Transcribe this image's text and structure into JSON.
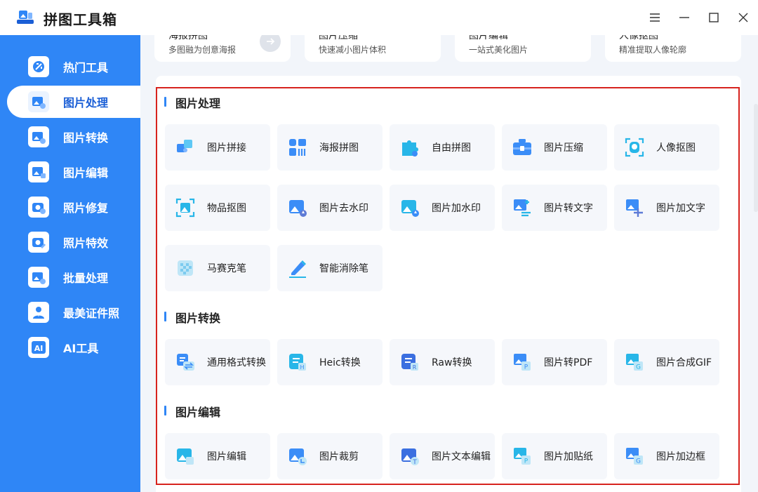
{
  "app": {
    "title": "拼图工具箱"
  },
  "window_controls": [
    "menu-icon",
    "minimize-icon",
    "maximize-icon",
    "close-icon"
  ],
  "colors": {
    "brand": "#2f86f6",
    "active_text": "#1b5fd6",
    "highlight_frame": "#d7231e"
  },
  "sidebar": {
    "items": [
      {
        "label": "热门工具",
        "icon": "tools-icon",
        "active": false
      },
      {
        "label": "图片处理",
        "icon": "image-process-icon",
        "active": true
      },
      {
        "label": "图片转换",
        "icon": "image-convert-icon",
        "active": false
      },
      {
        "label": "图片编辑",
        "icon": "image-edit-icon",
        "active": false
      },
      {
        "label": "照片修复",
        "icon": "photo-repair-icon",
        "active": false
      },
      {
        "label": "照片特效",
        "icon": "photo-effect-icon",
        "active": false
      },
      {
        "label": "批量处理",
        "icon": "batch-icon",
        "active": false
      },
      {
        "label": "最美证件照",
        "icon": "id-photo-icon",
        "active": false
      },
      {
        "label": "AI工具",
        "icon": "ai-icon",
        "active": false
      }
    ]
  },
  "promo_cards": [
    {
      "title": "海报拼图",
      "desc": "多图融为创意海报",
      "has_arrow": true
    },
    {
      "title": "图片压缩",
      "desc": "快速减小图片体积"
    },
    {
      "title": "图片编辑",
      "desc": "一站式美化图片"
    },
    {
      "title": "人像抠图",
      "desc": "精准提取人像轮廓"
    }
  ],
  "sections": [
    {
      "title": "图片处理",
      "tools": [
        {
          "label": "图片拼接",
          "icon": "puzzle-join-icon"
        },
        {
          "label": "海报拼图",
          "icon": "poster-grid-icon"
        },
        {
          "label": "自由拼图",
          "icon": "puzzle-piece-icon"
        },
        {
          "label": "图片压缩",
          "icon": "compress-box-icon"
        },
        {
          "label": "人像抠图",
          "icon": "portrait-cutout-icon"
        },
        {
          "label": "物品抠图",
          "icon": "object-cutout-icon"
        },
        {
          "label": "图片去水印",
          "icon": "remove-watermark-icon"
        },
        {
          "label": "图片加水印",
          "icon": "add-watermark-icon"
        },
        {
          "label": "图片转文字",
          "icon": "image-to-text-icon"
        },
        {
          "label": "图片加文字",
          "icon": "add-text-icon"
        },
        {
          "label": "马赛克笔",
          "icon": "mosaic-icon"
        },
        {
          "label": "智能消除笔",
          "icon": "eraser-pen-icon"
        }
      ]
    },
    {
      "title": "图片转换",
      "tools": [
        {
          "label": "通用格式转换",
          "icon": "format-convert-icon"
        },
        {
          "label": "Heic转换",
          "icon": "heic-icon"
        },
        {
          "label": "Raw转换",
          "icon": "raw-icon"
        },
        {
          "label": "图片转PDF",
          "icon": "to-pdf-icon"
        },
        {
          "label": "图片合成GIF",
          "icon": "to-gif-icon"
        }
      ]
    },
    {
      "title": "图片编辑",
      "tools": [
        {
          "label": "图片编辑",
          "icon": "edit-image-icon"
        },
        {
          "label": "图片裁剪",
          "icon": "crop-icon"
        },
        {
          "label": "图片文本编辑",
          "icon": "text-edit-icon"
        },
        {
          "label": "图片加贴纸",
          "icon": "sticker-icon"
        },
        {
          "label": "图片加边框",
          "icon": "frame-icon"
        }
      ]
    }
  ]
}
